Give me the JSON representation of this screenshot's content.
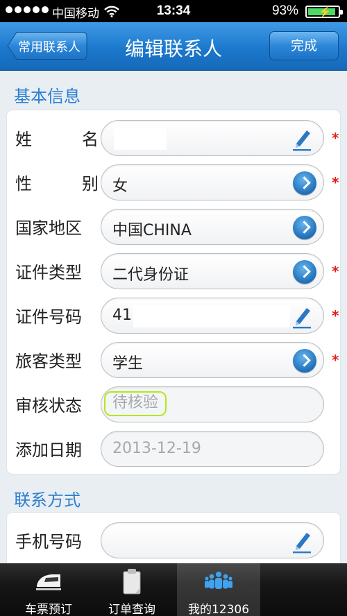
{
  "status_bar": {
    "carrier": "中国移动",
    "time": "13:34",
    "battery_percent": "93%",
    "battery_level": 0.93
  },
  "navbar": {
    "back_label": "常用联系人",
    "title": "编辑联系人",
    "done_label": "完成"
  },
  "basic_info": {
    "title": "基本信息",
    "rows": [
      {
        "label": "姓名",
        "value": "",
        "control": "pencil-icon",
        "required": true
      },
      {
        "label": "性别",
        "value": "女",
        "control": "arrow-icon",
        "required": true
      },
      {
        "label": "国家地区",
        "value": "中国CHINA",
        "control": "arrow-icon",
        "required": false
      },
      {
        "label": "证件类型",
        "value": "二代身份证",
        "control": "arrow-icon",
        "required": true
      },
      {
        "label": "证件号码",
        "value": "41",
        "control": "pencil-icon",
        "required": true
      },
      {
        "label": "旅客类型",
        "value": "学生",
        "control": "arrow-icon",
        "required": true
      },
      {
        "label": "审核状态",
        "value": "待核验",
        "control": "none",
        "required": false
      },
      {
        "label": "添加日期",
        "value": "2013-12-19",
        "control": "none",
        "required": false
      }
    ]
  },
  "contact_info": {
    "title": "联系方式",
    "rows": [
      {
        "label": "手机号码",
        "value": "",
        "control": "pencil-icon",
        "required": false
      }
    ]
  },
  "required_mark": "*",
  "tab_bar": {
    "tabs": [
      {
        "label": "车票预订",
        "icon": "train-icon",
        "active": false
      },
      {
        "label": "订单查询",
        "icon": "clipboard-icon",
        "active": false
      },
      {
        "label": "我的12306",
        "icon": "people-icon",
        "active": true
      }
    ]
  },
  "colors": {
    "navbar": "#1c78cc",
    "section_title": "#2a7fd0",
    "required_star": "#e0201a",
    "pending_highlight": "#b5e61d"
  }
}
